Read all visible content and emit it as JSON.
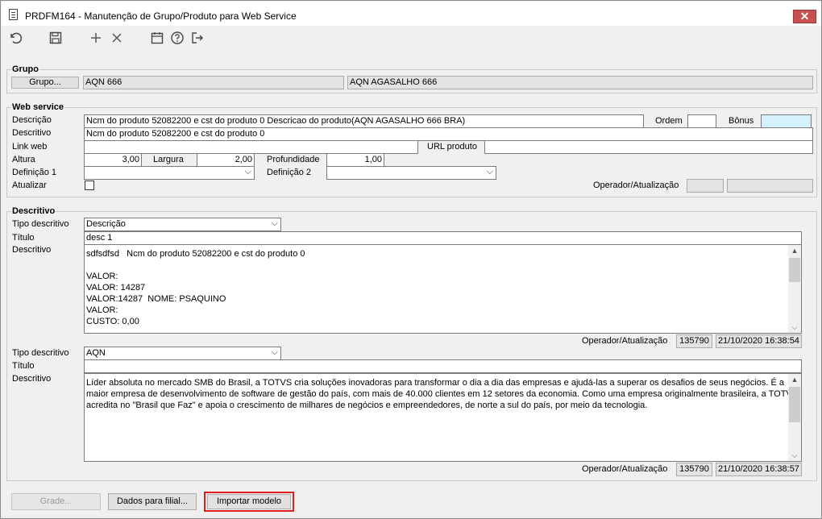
{
  "window": {
    "title": "PRDFM164 - Manutenção de Grupo/Produto para Web Service",
    "close_symbol": "✕"
  },
  "toolbar": {
    "undo_icon": "↶",
    "save_icon": "💾",
    "add_icon": "+",
    "delete_icon": "✕",
    "calendar_icon": "📅",
    "help_icon": "?",
    "exit_icon": "⇥"
  },
  "grupo": {
    "legend": "Grupo",
    "button_label": "Grupo...",
    "code": "AQN 666",
    "description": "AQN AGASALHO 666"
  },
  "web_service": {
    "legend": "Web service",
    "descricao_label": "Descrição",
    "descricao_value": "Ncm do produto 52082200 e cst do produto 0 Descricao do produto(AQN AGASALHO 666 BRA)",
    "ordem_label": "Ordem",
    "ordem_value": "",
    "bonus_label": "Bônus",
    "bonus_value": "",
    "descritivo_label": "Descritivo",
    "descritivo_value": "Ncm do produto 52082200 e cst do produto 0",
    "link_web_label": "Link web",
    "link_web_value": "",
    "url_produto_label": "URL produto",
    "url_produto_value": "",
    "altura_label": "Altura",
    "altura_value": "3,00",
    "largura_label": "Largura",
    "largura_value": "2,00",
    "profundidade_label": "Profundidade",
    "profundidade_value": "1,00",
    "definicao1_label": "Definição 1",
    "definicao1_value": "",
    "definicao2_label": "Definição 2",
    "definicao2_value": "",
    "atualizar_label": "Atualizar",
    "atualizar_checked": false,
    "operador_label": "Operador/Atualização",
    "operador_value": "",
    "atualizacao_value": ""
  },
  "descritivo": {
    "legend": "Descritivo",
    "block1": {
      "tipo_label": "Tipo descritivo",
      "tipo_value": "Descrição",
      "titulo_label": "Título",
      "titulo_value": "desc 1",
      "descritivo_label": "Descritivo",
      "lines": [
        "sdfsdfsd   Ncm do produto 52082200 e cst do produto 0",
        "",
        "VALOR:",
        "VALOR: 14287",
        "VALOR:14287  NOME: PSAQUINO",
        "VALOR:",
        "CUSTO: 0,00"
      ],
      "operador_label": "Operador/Atualização",
      "operador_value": "135790",
      "atualizacao_value": "21/10/2020 16:38:54"
    },
    "block2": {
      "tipo_label": "Tipo descritivo",
      "tipo_value": "AQN",
      "titulo_label": "Título",
      "titulo_value": "",
      "descritivo_label": "Descritivo",
      "lines": [
        "Líder absoluta no mercado SMB do Brasil, a TOTVS cria soluções inovadoras para transformar o dia a dia das empresas e ajudá-las a superar os desafios de seus negócios. É a",
        "maior empresa de desenvolvimento de software de gestão do país, com mais de 40.000 clientes em 12 setores da economia. Como uma empresa originalmente brasileira, a TOTVS",
        "acredita no \"Brasil que Faz\" e apoia o crescimento de milhares de negócios e empreendedores, de norte a sul do país, por meio da tecnologia."
      ],
      "operador_label": "Operador/Atualização",
      "operador_value": "135790",
      "atualizacao_value": "21/10/2020 16:38:57"
    }
  },
  "footer": {
    "grade_label": "Grade...",
    "dados_filial_label": "Dados para filial...",
    "importar_modelo_label": "Importar modelo"
  },
  "colors": {
    "highlight": "#e01e1e",
    "bonus_bg": "#d5f1fb",
    "close_bg": "#c75050"
  }
}
